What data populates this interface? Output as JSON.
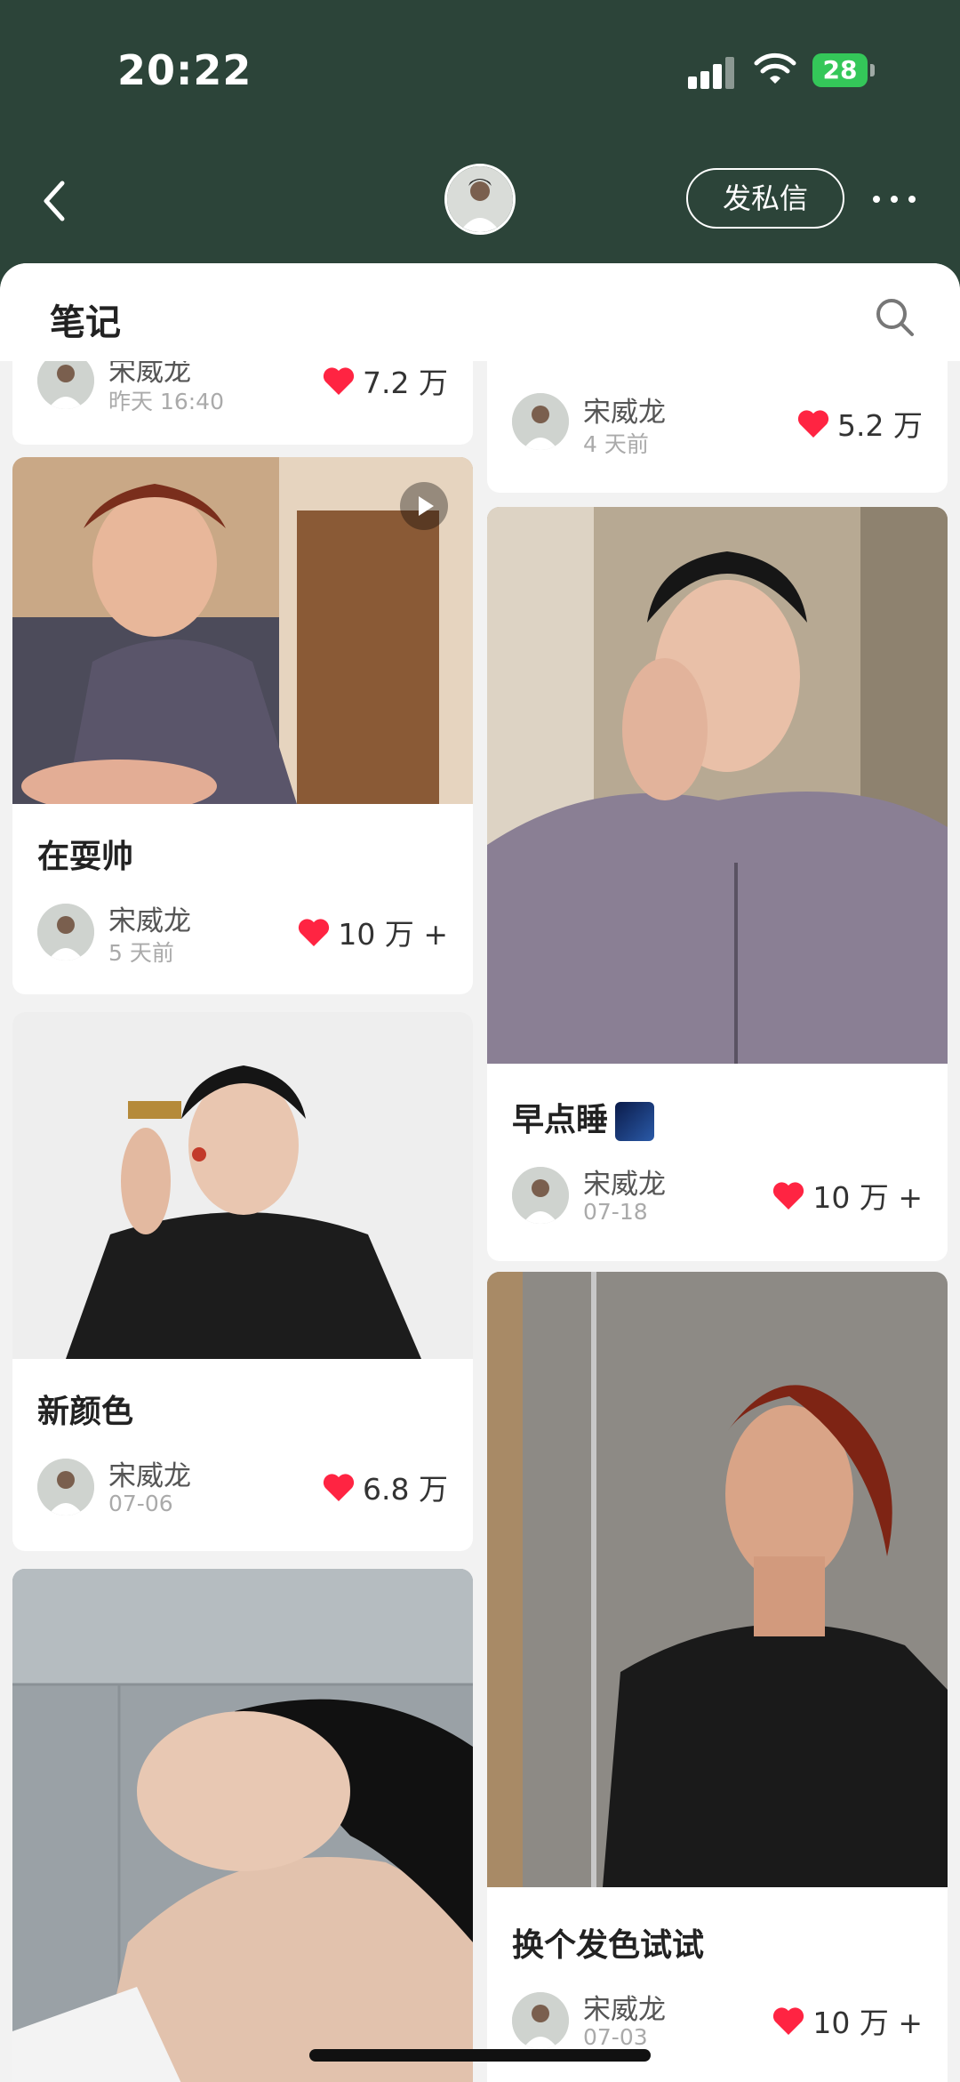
{
  "status_bar": {
    "time": "20:22",
    "battery": "28"
  },
  "header": {
    "back_icon": "chevron-left-icon",
    "dm_label": "发私信",
    "more_icon": "more-horizontal-icon"
  },
  "section": {
    "title": "笔记",
    "search_icon": "search-icon"
  },
  "colors": {
    "header_bg": "#2c4439",
    "heart": "#ff2442",
    "battery": "#34c759"
  },
  "left_column": [
    {
      "title": "",
      "author": "宋威龙",
      "time": "昨天 16:40",
      "likes": "7.2 万"
    },
    {
      "title": "在耍帅",
      "author": "宋威龙",
      "time": "5 天前",
      "likes": "10 万 +",
      "is_video": true
    },
    {
      "title": "新颜色",
      "author": "宋威龙",
      "time": "07-06",
      "likes": "6.8 万"
    },
    {
      "title": "",
      "author": "",
      "time": "",
      "likes": ""
    }
  ],
  "right_column": [
    {
      "title": "",
      "author": "宋威龙",
      "time": "4 天前",
      "likes": "5.2 万"
    },
    {
      "title": "早点睡",
      "author": "宋威龙",
      "time": "07-18",
      "likes": "10 万 +",
      "emoji": "sparkles-night"
    },
    {
      "title": "换个发色试试",
      "author": "宋威龙",
      "time": "07-03",
      "likes": "10 万 +"
    }
  ]
}
